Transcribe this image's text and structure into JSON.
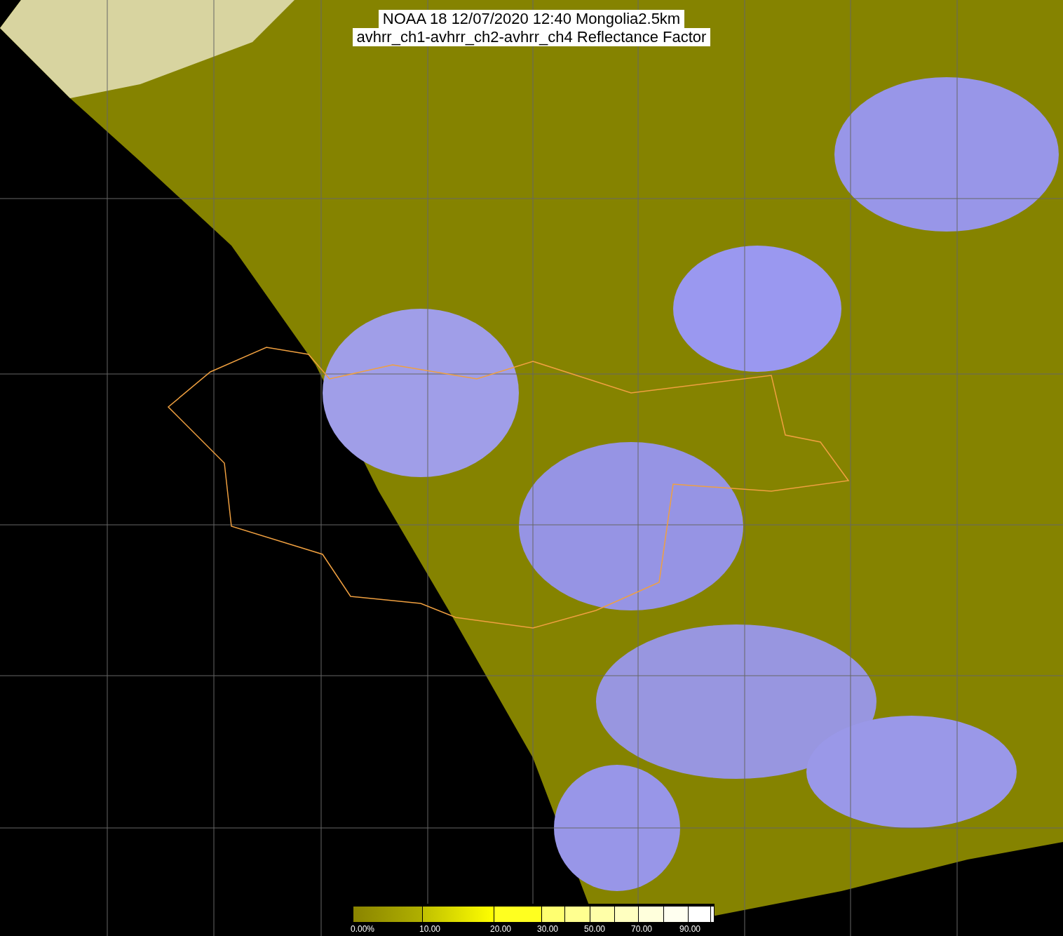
{
  "title": {
    "lines": [
      "NOAA 18 12/07/2020 12:40 Mongolia2.5km",
      "avhrr_ch1-avhrr_ch2-avhrr_ch4 Reflectance Factor"
    ]
  },
  "legend": {
    "labels": [
      "0.00%",
      "10.00",
      "20.00",
      "30.00",
      "50.00",
      "70.00",
      "90.00"
    ]
  }
}
